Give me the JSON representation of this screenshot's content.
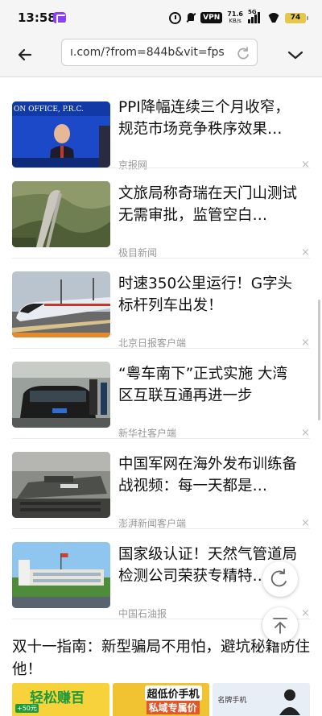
{
  "status_bar": {
    "time": "13:58",
    "vpn": "VPN",
    "speed_value": "71.6",
    "speed_unit": "KB/s",
    "signal_label": "5G",
    "battery": "74"
  },
  "browser": {
    "url": "ı.com/?from=844b&vit=fps",
    "icons": {
      "back": "back-arrow-icon",
      "reload": "reload-icon",
      "menu": "chevron-down-icon"
    }
  },
  "feed": {
    "items": [
      {
        "title": "PPI降幅连续三个月收窄，规范市场竞争秩序效果…",
        "source": "京报网",
        "thumb_text": "ON OFFICE, P.R.C."
      },
      {
        "title": "文旅局称奇瑞在天门山测试无需审批，监管空白…",
        "source": "极目新闻"
      },
      {
        "title": "时速350公里运行！G字头标杆列车出发！",
        "source": "北京日报客户端"
      },
      {
        "title": "“粤车南下”正式实施 大湾区互联互通再进一步",
        "source": "新华社客户端"
      },
      {
        "title": "中国军网在海外发布训练备战视频：每一天都是…",
        "source": "澎湃新闻客户端"
      },
      {
        "title": "国家级认证！天然气管道局检测公司荣获专精特…",
        "source": "中国石油报"
      }
    ],
    "headline": "双十一指南：新型骗局不用怕，避坑秘籍防住他！",
    "ads": [
      {
        "text": "轻松赚百",
        "badge": "+50元"
      },
      {
        "text": "超低价手机",
        "sub": "私域专属价"
      },
      {
        "text": "名牌手机"
      }
    ]
  },
  "floating": {
    "refresh_icon": "refresh-icon",
    "top_icon": "back-to-top-icon"
  },
  "colors": {
    "accent": "#f5f5f5",
    "source_text": "#999999",
    "ad_yellow": "#f7d23a"
  }
}
